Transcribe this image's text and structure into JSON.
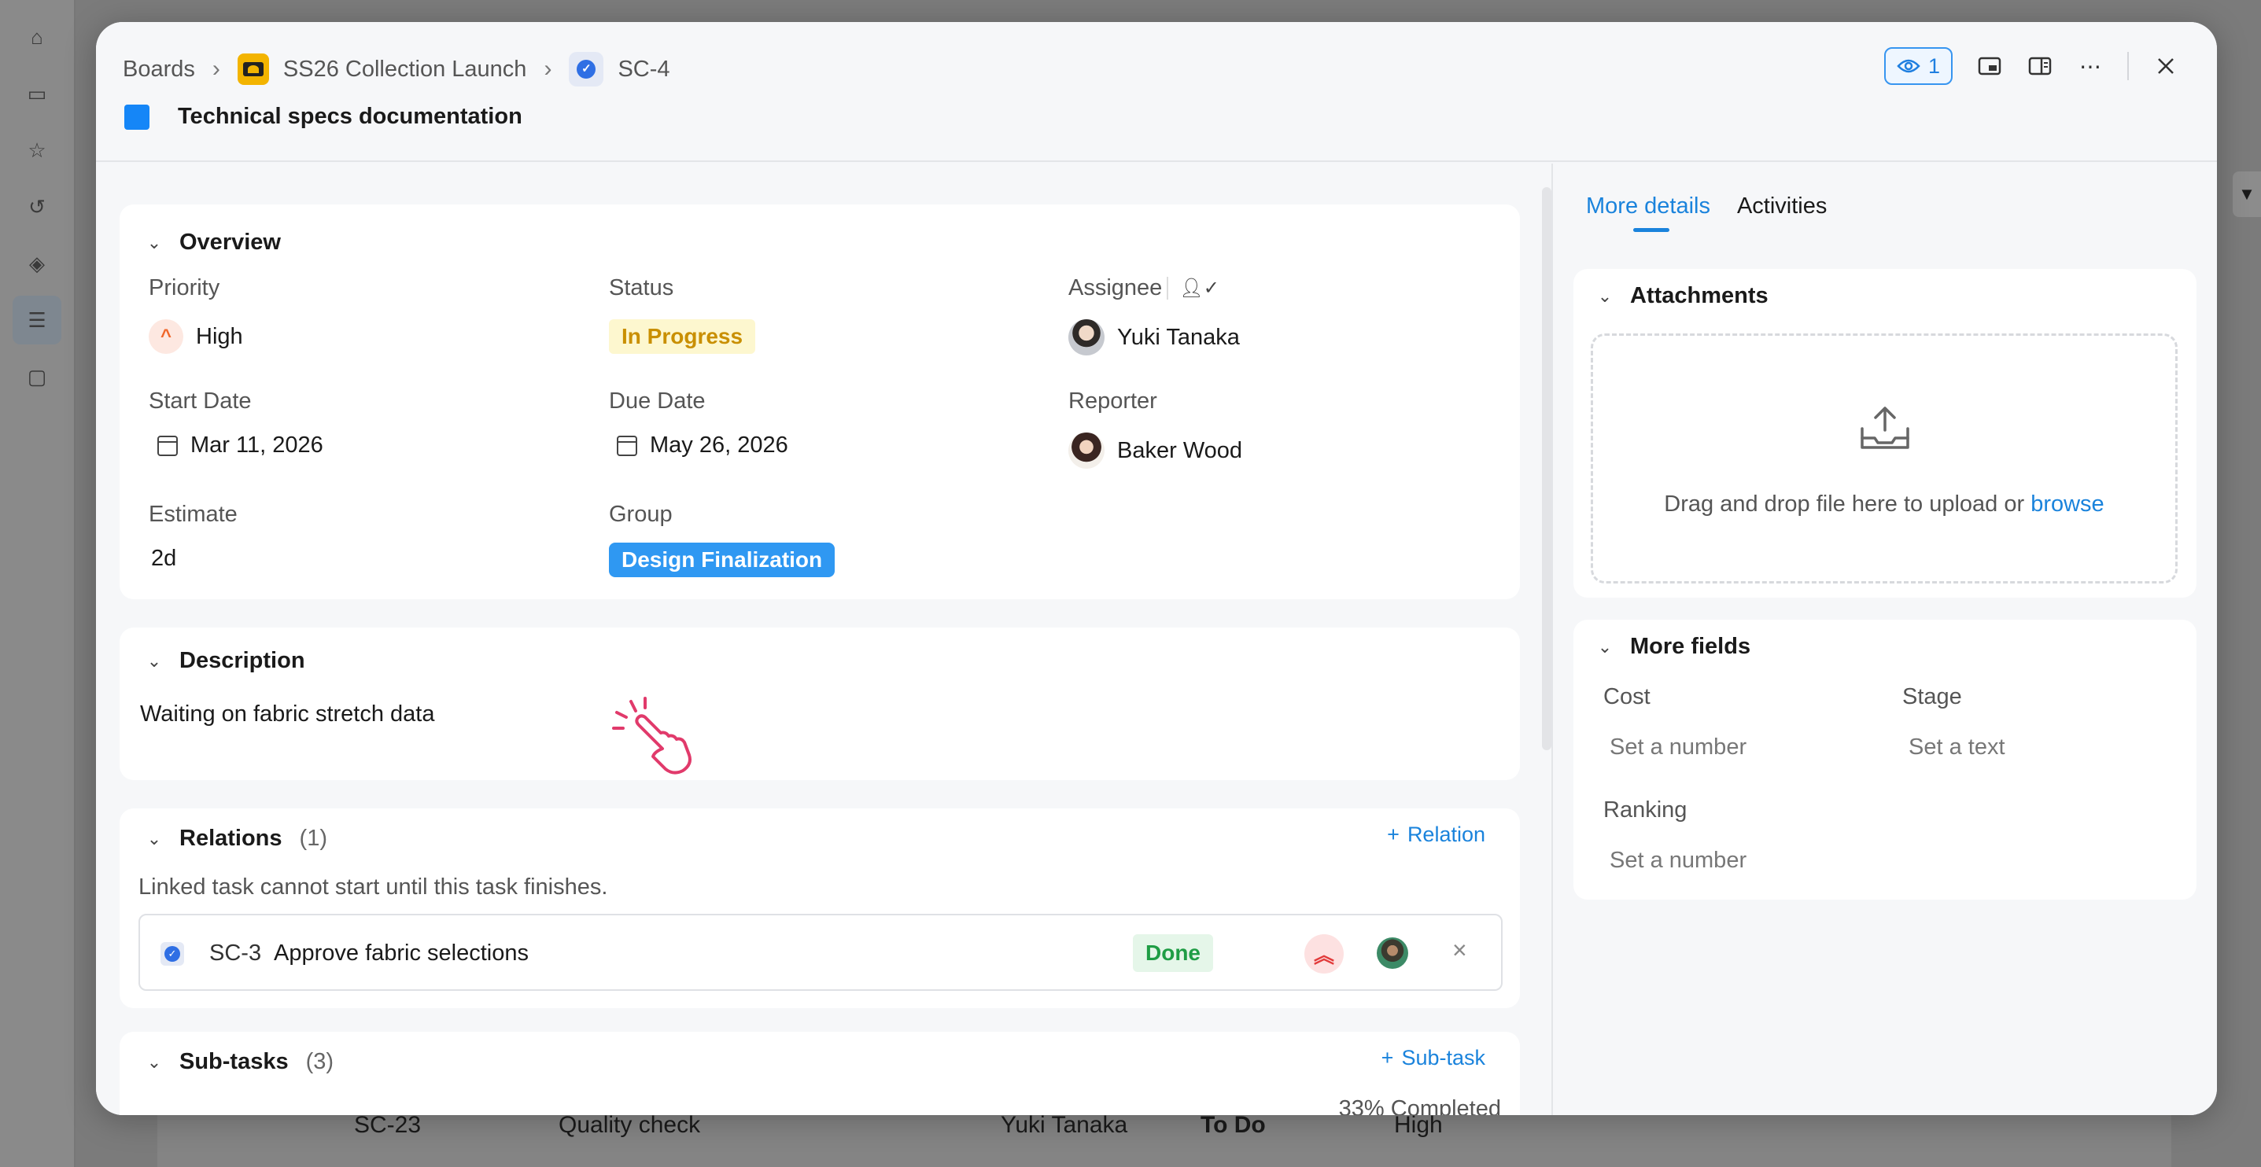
{
  "breadcrumb": {
    "root": "Boards",
    "project": "SS26 Collection Launch",
    "task_key": "SC-4"
  },
  "task": {
    "title": "Technical specs documentation",
    "color": "#1586f7"
  },
  "header_actions": {
    "watchers_count": "1"
  },
  "overview": {
    "section_title": "Overview",
    "priority": {
      "label": "Priority",
      "value": "High"
    },
    "status": {
      "label": "Status",
      "value": "In Progress"
    },
    "assignee": {
      "label": "Assignee",
      "value": "Yuki Tanaka"
    },
    "start_date": {
      "label": "Start Date",
      "value": "Mar 11, 2026"
    },
    "due_date": {
      "label": "Due Date",
      "value": "May 26, 2026"
    },
    "reporter": {
      "label": "Reporter",
      "value": "Baker Wood"
    },
    "estimate": {
      "label": "Estimate",
      "value": "2d"
    },
    "group": {
      "label": "Group",
      "value": "Design Finalization"
    }
  },
  "description": {
    "section_title": "Description",
    "text": "Waiting on fabric stretch data"
  },
  "relations": {
    "section_title": "Relations",
    "count": "(1)",
    "add_label": "Relation",
    "note": "Linked task cannot start until this task finishes.",
    "items": [
      {
        "key": "SC-3",
        "title": "Approve fabric selections",
        "status": "Done"
      }
    ]
  },
  "subtasks": {
    "section_title": "Sub-tasks",
    "count": "(3)",
    "add_label": "Sub-task",
    "progress_text": "33% Completed",
    "progress_fraction": 0.33
  },
  "right_panel": {
    "tabs": [
      "More details",
      "Activities"
    ],
    "active_tab": "More details",
    "attachments": {
      "section_title": "Attachments",
      "drop_text": "Drag and drop file here to upload or",
      "browse_label": "browse"
    },
    "more_fields": {
      "section_title": "More fields",
      "cost": {
        "label": "Cost",
        "placeholder": "Set a number"
      },
      "stage": {
        "label": "Stage",
        "placeholder": "Set a text"
      },
      "ranking": {
        "label": "Ranking",
        "placeholder": "Set a number"
      }
    }
  },
  "background_row": {
    "key": "SC-23",
    "title": "Quality check",
    "assignee": "Yuki Tanaka",
    "status": "To Do",
    "priority": "High"
  }
}
